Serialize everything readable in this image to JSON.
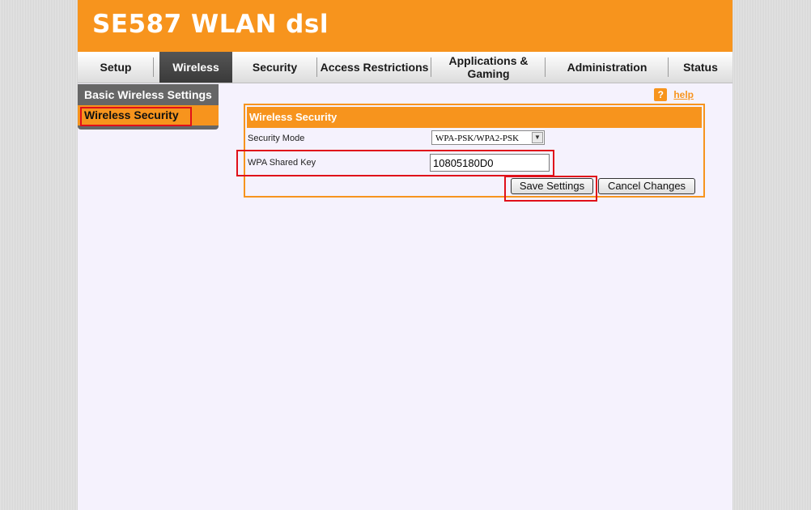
{
  "app": {
    "title": "SE587 WLAN dsl"
  },
  "nav": {
    "tabs": [
      {
        "label": "Setup"
      },
      {
        "label": "Wireless",
        "active": true
      },
      {
        "label": "Security"
      },
      {
        "label": "Access Restrictions"
      },
      {
        "label": "Applications &",
        "label2": "Gaming"
      },
      {
        "label": "Administration"
      },
      {
        "label": "Status"
      }
    ]
  },
  "sidebar": {
    "items": [
      {
        "label": "Basic Wireless Settings"
      },
      {
        "label": "Wireless Security",
        "active": true
      }
    ]
  },
  "help": {
    "icon": "?",
    "label": "help"
  },
  "panel": {
    "title": "Wireless Security",
    "security_mode": {
      "label": "Security Mode",
      "value": "WPA-PSK/WPA2-PSK"
    },
    "shared_key": {
      "label": "WPA Shared Key",
      "value": "10805180D0"
    },
    "save_label": "Save Settings",
    "cancel_label": "Cancel Changes"
  },
  "colors": {
    "accent": "#f7941d",
    "highlight": "#e0101a",
    "nav_active": "#444444"
  }
}
